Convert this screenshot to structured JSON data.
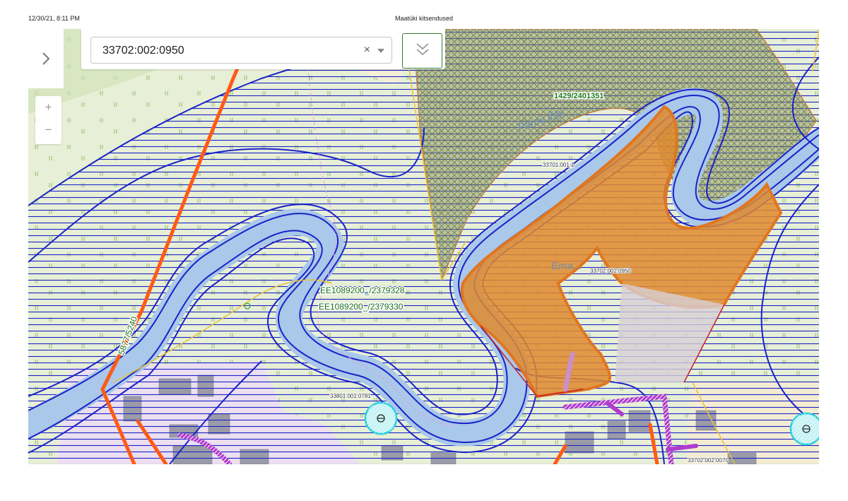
{
  "print_header": {
    "datetime": "12/30/21, 8:11 PM",
    "title": "Maatüki kitsendused"
  },
  "search": {
    "value": "33702:002:0950",
    "clear_symbol": "×"
  },
  "zoom": {
    "in_label": "+",
    "out_label": "−"
  },
  "map_labels": {
    "protected_area_1": "1429/2401351",
    "well_1": "EE1089200_/2379328",
    "well_2": "EE1089200_/2379330",
    "road_code": "5877/5240",
    "parcel_a": "33801:001:0781",
    "parcel_b": "33702:002:0070",
    "parcel_c": "33701:001:1",
    "parcel_d": "33702:002:0950",
    "river_name": "Pärnu jõgi",
    "place_name": "Ema..."
  },
  "colors": {
    "land": "#e7efd6",
    "water": "#a9c8ea",
    "restriction_lines": "#1a22c8",
    "selected_parcel": "#e08a2e",
    "road": "#ff5a14",
    "pipeline": "#b03ccf",
    "protected_zone": "#3aa23a"
  }
}
